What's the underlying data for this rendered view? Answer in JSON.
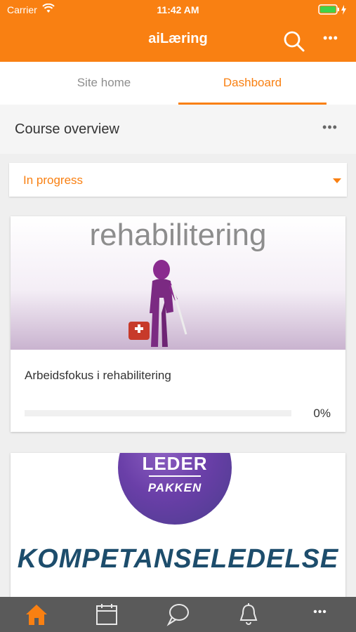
{
  "status_bar": {
    "carrier": "Carrier",
    "time": "11:42 AM"
  },
  "header": {
    "title": "aiLæring",
    "more_label": "•••"
  },
  "tabs": [
    {
      "label": "Site home",
      "active": false
    },
    {
      "label": "Dashboard",
      "active": true
    }
  ],
  "section": {
    "title": "Course overview",
    "more_label": "•••"
  },
  "filter": {
    "value": "In progress"
  },
  "courses": [
    {
      "image_text": "rehabilitering",
      "name": "Arbeidsfokus i rehabilitering",
      "progress": 0,
      "progress_text": "0%"
    },
    {
      "image_text_1": "LEDER",
      "image_text_2": "PAKKEN",
      "image_text_3": "KOMPETANSELEDELSE"
    }
  ],
  "bottom_nav": {
    "items": [
      "home-icon",
      "calendar-icon",
      "messages-icon",
      "notifications-icon",
      "more-icon"
    ],
    "more_label": "•••"
  },
  "colors": {
    "accent": "#f98012",
    "nav_bg": "#5a5a5a",
    "active_nav": "#f98012"
  }
}
